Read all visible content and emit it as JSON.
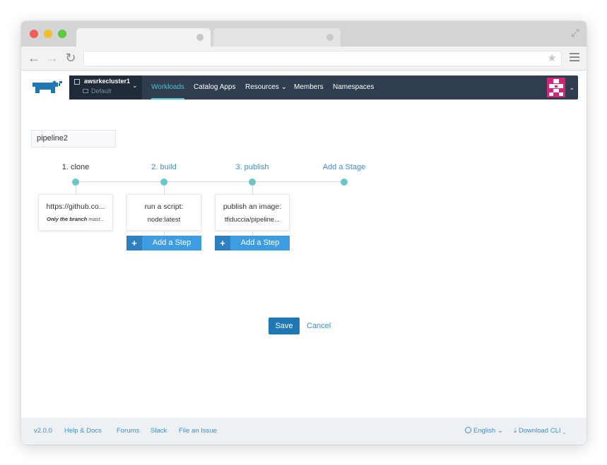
{
  "app": {
    "cluster_name": "awsrkecluster1",
    "namespace_name": "Default"
  },
  "nav": {
    "items": [
      {
        "label": "Workloads"
      },
      {
        "label": "Catalog Apps"
      },
      {
        "label": "Resources"
      },
      {
        "label": "Members"
      },
      {
        "label": "Namespaces"
      }
    ]
  },
  "pipeline": {
    "name": "pipeline2",
    "stages": [
      {
        "title": "1. clone",
        "step_line1": "https://github.co...",
        "step_line2_bold": "Only the branch",
        "step_line2_rest": "mast..."
      },
      {
        "title": "2. build",
        "step_line1": "run a script:",
        "step_line2": "node:latest",
        "add_step_label": "Add a Step"
      },
      {
        "title": "3. publish",
        "step_line1": "publish an image:",
        "step_line2": "tfiduccia/pipeline...",
        "add_step_label": "Add a Step"
      }
    ],
    "add_stage_label": "Add a Stage"
  },
  "actions": {
    "save_label": "Save",
    "cancel_label": "Cancel"
  },
  "footer": {
    "version": "v2.0.0",
    "help_docs": "Help & Docs",
    "forums": "Forums",
    "slack": "Slack",
    "file_issue": "File an Issue",
    "language": "English",
    "download_cli": "Download CLI"
  },
  "colors": {
    "navbar": "#2f3d4f",
    "accent": "#3d9de0",
    "active_nav": "#4fc3d9",
    "stage_dot": "#6cc5c7",
    "avatar": "#d2247a"
  }
}
